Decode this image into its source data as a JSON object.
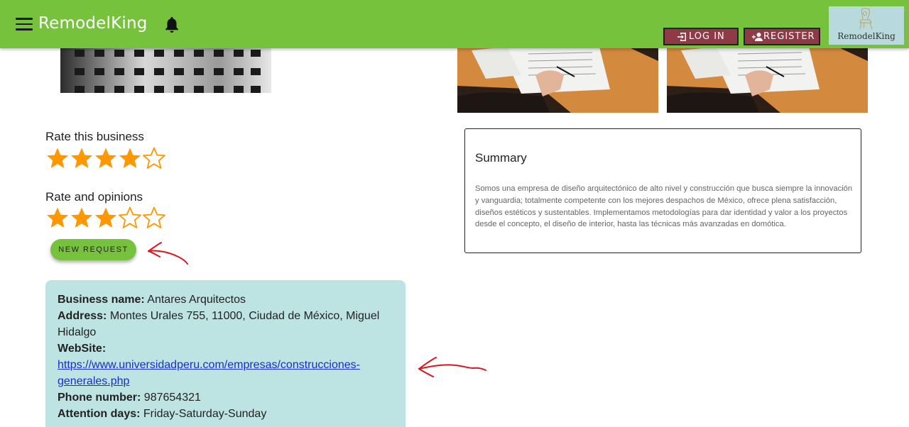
{
  "header": {
    "brand": "RemodelKing",
    "login_label": "LOG IN",
    "register_label": "REGISTER",
    "logo_text": "RemodelKing"
  },
  "rating": {
    "rate_label": "Rate this business",
    "rate_stars": 4,
    "opinions_label": "Rate and opinions",
    "opinions_stars": 3,
    "max_stars": 5
  },
  "actions": {
    "new_request_label": "NEW REQUEST"
  },
  "summary": {
    "title": "Summary",
    "text": "Somos una empresa de diseño arquitectónico de alto nivel y construcción que busca siempre la innovación y vanguardia; totalmente competente con los mejores despachos de México, ofrece plena satisfacción, diseños estéticos y sustentables. Implementamos metodologías para dar identidad y valor a los proyectos desde el concepto, el diseño de interior, hasta las técnicas más avanzadas en domótica."
  },
  "business": {
    "name_label": "Business name:",
    "name": "Antares Arquitectos",
    "address_label": "Address:",
    "address": "Montes Urales 755, 11000, Ciudad de México, Miguel Hidalgo",
    "website_label": "WebSite:",
    "website": "https://www.universidadperu.com/empresas/construcciones-generales.php",
    "phone_label": "Phone number:",
    "phone": "987654321",
    "days_label": "Attention days:",
    "days": "Friday-Saturday-Sunday"
  },
  "colors": {
    "header_green": "#77c23c",
    "auth_button": "#8e3b46",
    "star": "#ff9800",
    "info_bg": "#bde3e3",
    "annotation": "#e0141e"
  },
  "icons": [
    "menu-icon",
    "bell-icon",
    "login-icon",
    "register-icon",
    "star-icon"
  ]
}
